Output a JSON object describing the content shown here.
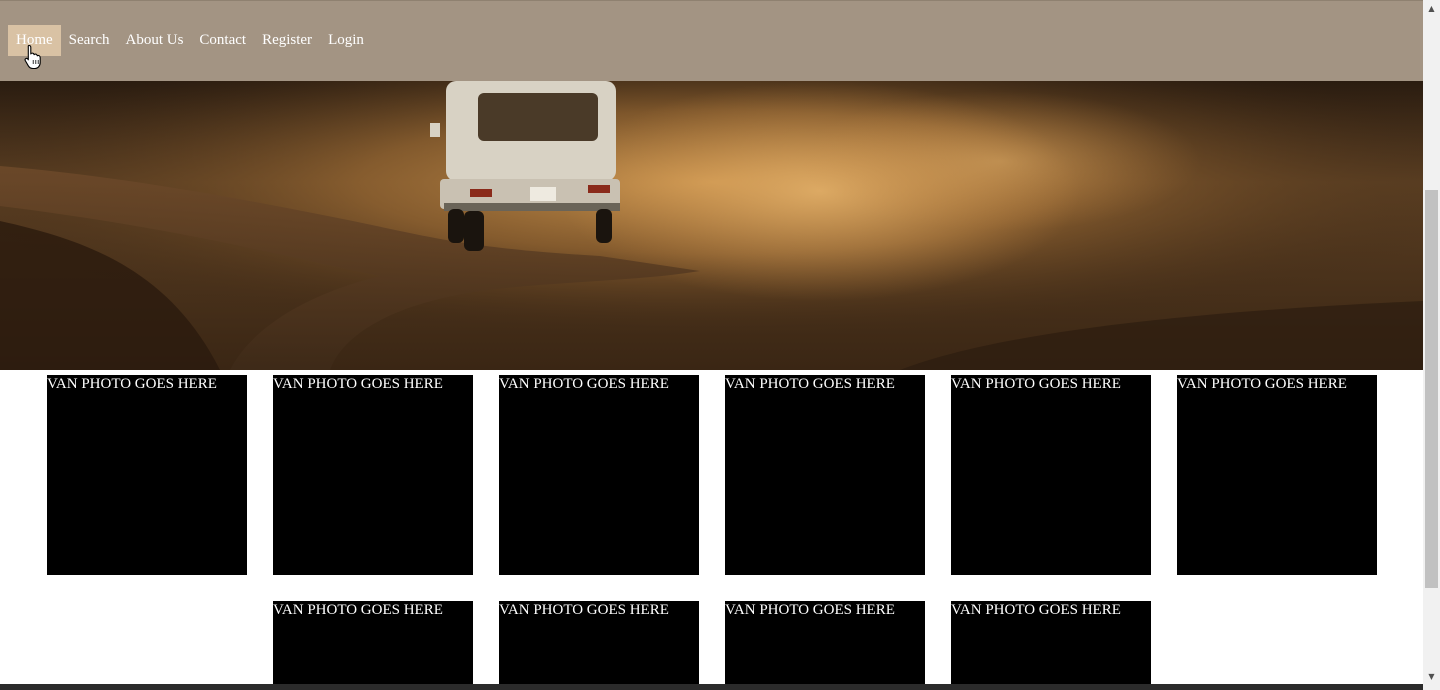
{
  "nav": {
    "items": [
      {
        "label": "Home",
        "active": true
      },
      {
        "label": "Search",
        "active": false
      },
      {
        "label": "About Us",
        "active": false
      },
      {
        "label": "Contact",
        "active": false
      },
      {
        "label": "Register",
        "active": false
      },
      {
        "label": "Login",
        "active": false
      }
    ]
  },
  "hero": {
    "image": "van-on-dirt-road-photo"
  },
  "gallery": {
    "tiles": [
      {
        "label": "VAN PHOTO GOES HERE"
      },
      {
        "label": "VAN PHOTO GOES HERE"
      },
      {
        "label": "VAN PHOTO GOES HERE"
      },
      {
        "label": "VAN PHOTO GOES HERE"
      },
      {
        "label": "VAN PHOTO GOES HERE"
      },
      {
        "label": "VAN PHOTO GOES HERE"
      },
      {
        "label": "VAN PHOTO GOES HERE"
      },
      {
        "label": "VAN PHOTO GOES HERE"
      },
      {
        "label": "VAN PHOTO GOES HERE"
      },
      {
        "label": "VAN PHOTO GOES HERE"
      }
    ]
  },
  "colors": {
    "navbar": "#a39483",
    "nav_active": "#d9c2a4",
    "tile": "#000000"
  }
}
